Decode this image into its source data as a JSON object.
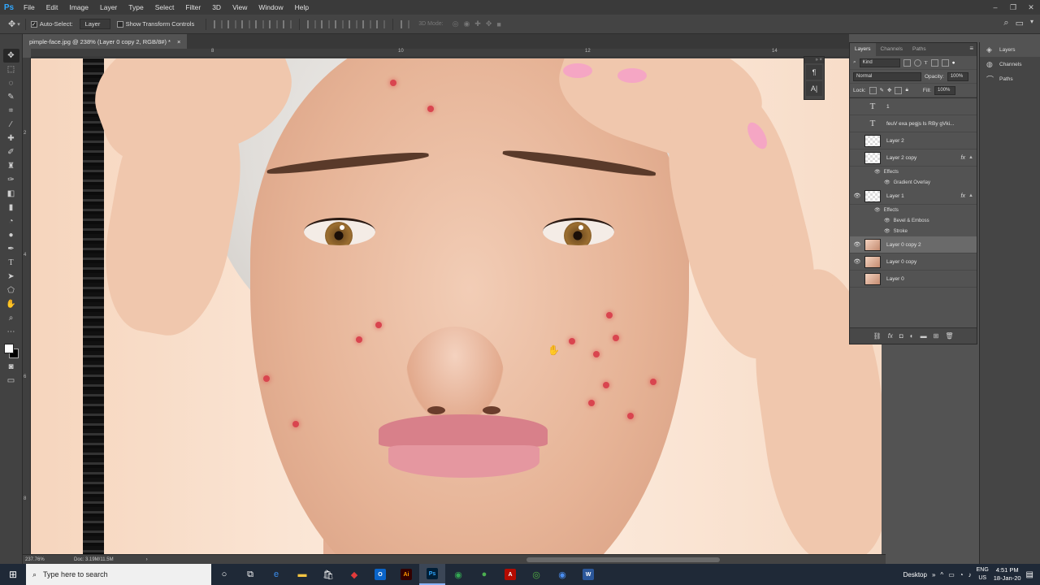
{
  "app": {
    "logo": "Ps"
  },
  "menu": [
    "File",
    "Edit",
    "Image",
    "Layer",
    "Type",
    "Select",
    "Filter",
    "3D",
    "View",
    "Window",
    "Help"
  ],
  "options": {
    "auto_select_label": "Auto-Select:",
    "auto_select_value": "Layer",
    "show_transform_label": "Show Transform Controls",
    "mode_label": "3D Mode:"
  },
  "document": {
    "tab_title": "pimple-face.jpg @ 238% (Layer 0 copy 2, RGB/8#) *",
    "close": "×"
  },
  "rulers": {
    "top": [
      "8",
      "10",
      "12",
      "14",
      "16"
    ],
    "left": [
      "2",
      "4",
      "6",
      "8"
    ]
  },
  "mini_panel": {
    "top": "» ×",
    "btn1": "¶",
    "btn2": "A|"
  },
  "layers_panel": {
    "tabs": [
      "Layers",
      "Channels",
      "Paths"
    ],
    "menu_icon": "≡",
    "filter_kind": "Kind",
    "blend_mode": "Normal",
    "opacity_label": "Opacity:",
    "opacity_value": "100%",
    "lock_label": "Lock:",
    "fill_label": "Fill:",
    "fill_value": "100%",
    "layers": [
      {
        "name": "1",
        "type": "text",
        "visible": false
      },
      {
        "name": "feuV exa pegjs ls  RBy gVki...",
        "type": "text",
        "visible": false
      },
      {
        "name": "Layer 2",
        "type": "transparent",
        "visible": false
      },
      {
        "name": "Layer 2 copy",
        "type": "transparent",
        "visible": false,
        "fx": true
      },
      {
        "name": "Layer 1",
        "type": "transparent",
        "visible": true,
        "fx": true
      },
      {
        "name": "Layer 0 copy 2",
        "type": "photo",
        "visible": true,
        "selected": true
      },
      {
        "name": "Layer 0 copy",
        "type": "photo",
        "visible": true
      },
      {
        "name": "Layer 0",
        "type": "photo",
        "visible": false
      }
    ],
    "effects_2copy": {
      "label": "Effects",
      "items": [
        "Gradient Overlay"
      ]
    },
    "effects_1": {
      "label": "Effects",
      "items": [
        "Bevel & Emboss",
        "Stroke"
      ]
    },
    "fx_label": "fx"
  },
  "side_dock": [
    "Layers",
    "Channels",
    "Paths"
  ],
  "status": {
    "zoom": "237.76%",
    "doc": "Doc: 3.19M/11.5M"
  },
  "taskbar": {
    "search_placeholder": "Type here to search",
    "desktop_label": "Desktop",
    "lang_top": "ENG",
    "lang_bottom": "US",
    "time": "4:51 PM",
    "date": "18-Jan-20"
  }
}
